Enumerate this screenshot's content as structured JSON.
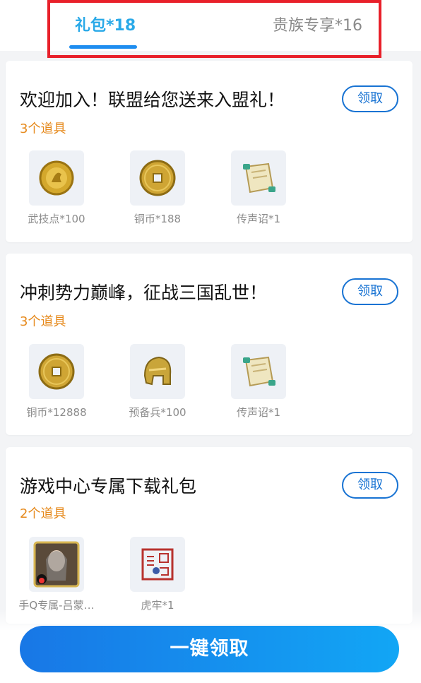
{
  "tabs": [
    {
      "label": "礼包*18",
      "active": true
    },
    {
      "label": "贵族专享*16",
      "active": false
    }
  ],
  "colors": {
    "accent": "#29a9e8",
    "button_blue": "#1873d3",
    "count_orange": "#e68a1d",
    "highlight_red": "#e8202a"
  },
  "packs": [
    {
      "title": "欢迎加入！联盟给您送来入盟礼！",
      "count": "3个道具",
      "claim_label": "领取",
      "items": [
        {
          "label": "武技点*100",
          "icon": "gold-emblem-coin-icon"
        },
        {
          "label": "铜币*188",
          "icon": "copper-coin-icon"
        },
        {
          "label": "传声诏*1",
          "icon": "scroll-icon"
        }
      ]
    },
    {
      "title": "冲刺势力巅峰，征战三国乱世！",
      "count": "3个道具",
      "claim_label": "领取",
      "items": [
        {
          "label": "铜币*12888",
          "icon": "copper-coin-icon"
        },
        {
          "label": "预备兵*100",
          "icon": "golden-helmet-icon"
        },
        {
          "label": "传声诏*1",
          "icon": "scroll-icon"
        }
      ]
    },
    {
      "title": "游戏中心专属下载礼包",
      "count": "2个道具",
      "claim_label": "领取",
      "items": [
        {
          "label": "手Q专属-吕蒙…",
          "icon": "character-portrait-icon"
        },
        {
          "label": "虎牢*1",
          "icon": "red-seal-icon"
        }
      ]
    }
  ],
  "footer": {
    "one_key_label": "一键领取"
  }
}
